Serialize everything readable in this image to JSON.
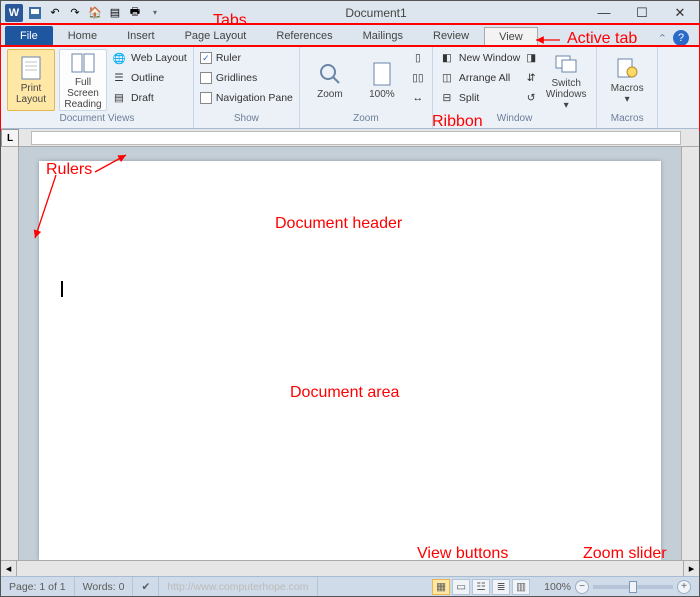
{
  "title": "Document1",
  "qat_icons": [
    "save-icon",
    "undo-icon",
    "redo-icon",
    "home-icon",
    "sheet-icon",
    "print-icon",
    "spellcheck-icon"
  ],
  "tabs": {
    "file": "File",
    "items": [
      "Home",
      "Insert",
      "Page Layout",
      "References",
      "Mailings",
      "Review",
      "View"
    ],
    "active_index": 6
  },
  "ribbon": {
    "views_big": [
      {
        "label": "Print\nLayout",
        "selected": true,
        "icon": "page-icon"
      },
      {
        "label": "Full Screen\nReading",
        "selected": false,
        "icon": "book-icon"
      }
    ],
    "views_small": [
      {
        "icon": "web-layout-icon",
        "label": "Web Layout"
      },
      {
        "icon": "outline-icon",
        "label": "Outline"
      },
      {
        "icon": "draft-icon",
        "label": "Draft"
      }
    ],
    "views_group_label": "Document Views",
    "show": [
      {
        "checked": true,
        "label": "Ruler"
      },
      {
        "checked": false,
        "label": "Gridlines"
      },
      {
        "checked": false,
        "label": "Navigation Pane"
      }
    ],
    "show_group_label": "Show",
    "zoom_big": [
      {
        "label": "Zoom",
        "icon": "magnifier-icon"
      },
      {
        "label": "100%",
        "icon": "page-100-icon"
      }
    ],
    "zoom_group_label": "Zoom",
    "zoom_small": [
      {
        "icon": "one-page-icon",
        "label": ""
      },
      {
        "icon": "two-pages-icon",
        "label": ""
      },
      {
        "icon": "page-width-icon",
        "label": ""
      }
    ],
    "window_small": [
      {
        "icon": "new-window-icon",
        "label": "New Window"
      },
      {
        "icon": "arrange-icon",
        "label": "Arrange All"
      },
      {
        "icon": "split-icon",
        "label": "Split"
      }
    ],
    "window_big": [
      {
        "label": "Switch\nWindows ▾",
        "icon": "switch-windows-icon"
      }
    ],
    "window_group_label": "Window",
    "macros_big": {
      "label": "Macros\n▾",
      "icon": "macros-icon"
    },
    "macros_group_label": "Macros"
  },
  "status": {
    "page": "Page: 1 of 1",
    "words": "Words: 0",
    "url_hint": "http://www.computerhope.com",
    "zoom_pct": "100%"
  },
  "annotations": {
    "tabs": "Tabs",
    "active_tab": "Active tab",
    "ribbon": "Ribbon",
    "rulers": "Rulers",
    "doc_header": "Document header",
    "doc_area": "Document area",
    "view_buttons": "View buttons",
    "zoom_slider": "Zoom slider"
  }
}
